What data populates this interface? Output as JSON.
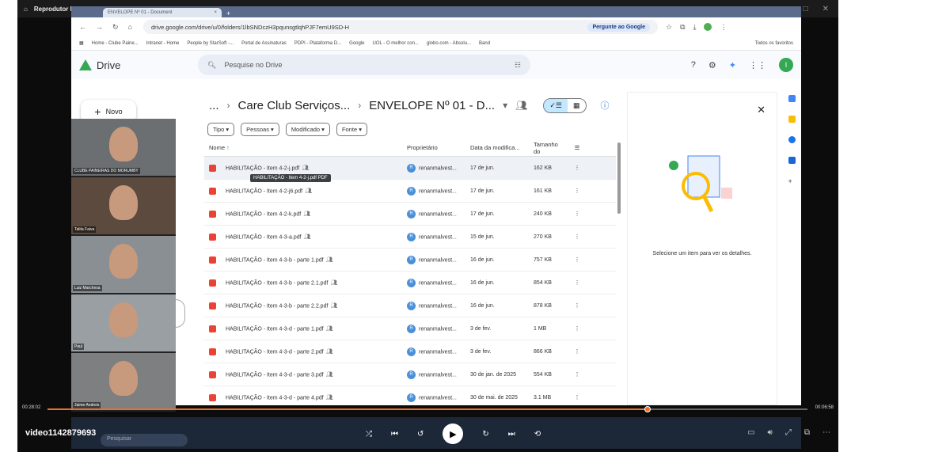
{
  "player": {
    "title": "Reprodutor Multimídia",
    "video_name": "video1142879693",
    "time_elapsed": "00:28:02",
    "time_total": "00:06:58",
    "progress": 0.79
  },
  "browser": {
    "tab_title": "ENVELOPE Nº 01 - Document",
    "url": "drive.google.com/drive/u/0/folders/1lbSNDczH3pqunsgtlqhPJF7emU9SD-H",
    "ask_google": "Pergunte ao Google",
    "bookmarks": [
      "Home - Clube Paine...",
      "Intranet - Home",
      "People by StarSoft -...",
      "Portal de Assinaturas",
      "PDPI - Plataforma D...",
      "Google",
      "UOL - O melhor con...",
      "globo.com - Absolu...",
      "Band"
    ],
    "favorites": "Todos os favoritos"
  },
  "drive": {
    "app": "Drive",
    "search_placeholder": "Pesquise no Drive",
    "new_button": "Novo",
    "user_initial": "I",
    "breadcrumb": {
      "ellipsis": "...",
      "folder1": "Care Club Serviços...",
      "folder2": "ENVELOPE Nº 01 - D..."
    },
    "filters": [
      "Tipo",
      "Pessoas",
      "Modificado",
      "Fonte"
    ],
    "columns": {
      "name": "Nome",
      "owner": "Proprietário",
      "date": "Data da modifica...",
      "size": "Tamanho do"
    },
    "tooltip": "HABILITAÇÃO - Item 4-2-j.pdf PDF",
    "files": [
      {
        "name": "HABILITAÇÃO - Item 4-2-j.pdf",
        "owner": "renanmalvest...",
        "date": "17 de jun.",
        "size": "162 KB"
      },
      {
        "name": "HABILITAÇÃO - Item 4-2-j6.pdf",
        "owner": "renanmalvest...",
        "date": "17 de jun.",
        "size": "161 KB"
      },
      {
        "name": "HABILITAÇÃO - Item 4-2-k.pdf",
        "owner": "renanmalvest...",
        "date": "17 de jun.",
        "size": "240 KB"
      },
      {
        "name": "HABILITAÇÃO - Item 4-3-a.pdf",
        "owner": "renanmalvest...",
        "date": "15 de jun.",
        "size": "270 KB"
      },
      {
        "name": "HABILITAÇÃO - Item 4-3-b - parte 1.pdf",
        "owner": "renanmalvest...",
        "date": "16 de jun.",
        "size": "757 KB"
      },
      {
        "name": "HABILITAÇÃO - Item 4-3-b - parte 2.1.pdf",
        "owner": "renanmalvest...",
        "date": "16 de jun.",
        "size": "854 KB"
      },
      {
        "name": "HABILITAÇÃO - Item 4-3-b - parte 2.2.pdf",
        "owner": "renanmalvest...",
        "date": "16 de jun.",
        "size": "878 KB"
      },
      {
        "name": "HABILITAÇÃO - Item 4-3-d - parte 1.pdf",
        "owner": "renanmalvest...",
        "date": "3 de fev.",
        "size": "1 MB"
      },
      {
        "name": "HABILITAÇÃO - Item 4-3-d - parte 2.pdf",
        "owner": "renanmalvest...",
        "date": "3 de fev.",
        "size": "866 KB"
      },
      {
        "name": "HABILITAÇÃO - Item 4-3-d - parte 3.pdf",
        "owner": "renanmalvest...",
        "date": "30 de jan. de 2025",
        "size": "554 KB"
      },
      {
        "name": "HABILITAÇÃO - Item 4-3-d - parte 4.pdf",
        "owner": "renanmalvest...",
        "date": "30 de mai. de 2025",
        "size": "3.1 MB"
      }
    ],
    "details_msg": "Selecione um item para ver os detalhes."
  },
  "participants": [
    "CLUBE PAINEIRAS DO MORUMBY",
    "Talita Faiva",
    "Luiz Marchesa",
    "Paul",
    "Jaime Andreis"
  ],
  "taskbar": {
    "search": "Pesquisar"
  }
}
